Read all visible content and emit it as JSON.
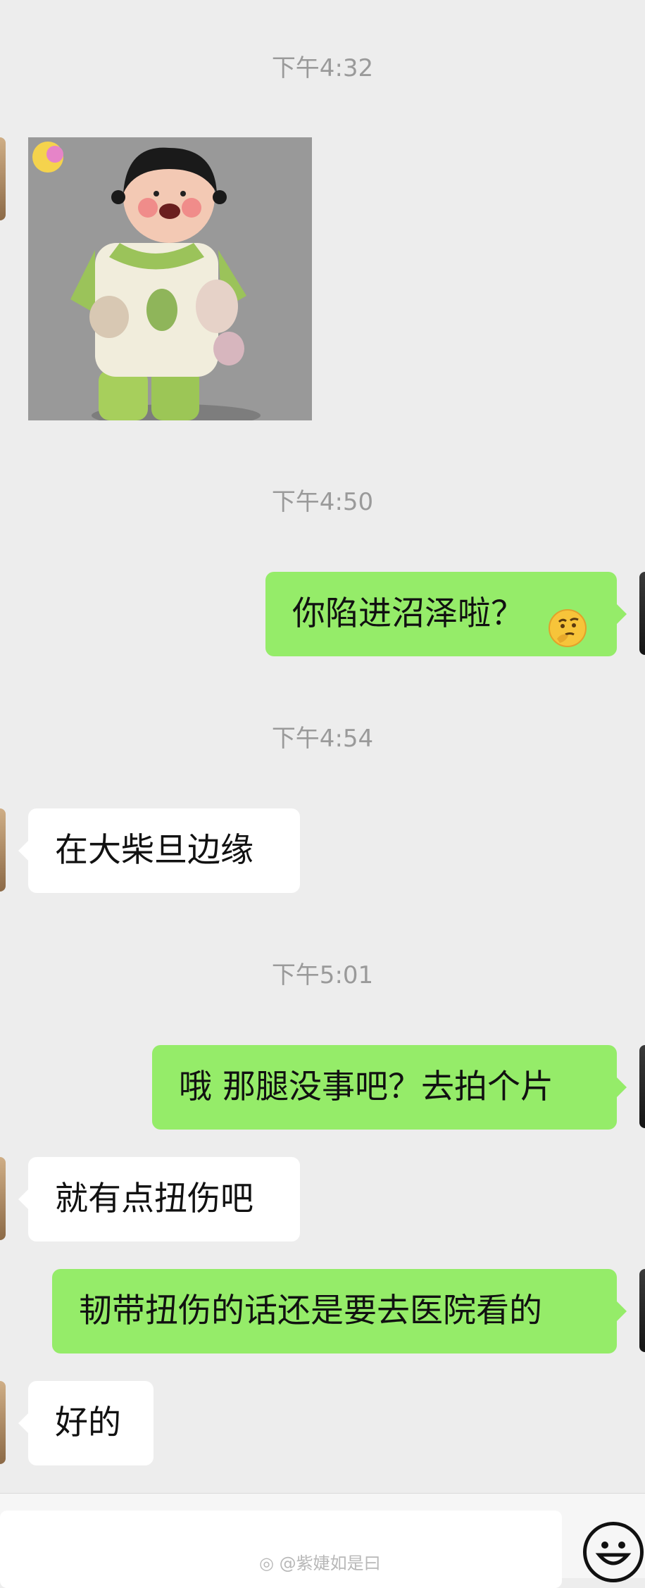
{
  "messages": {
    "time1": "下午4:32",
    "time2": "下午4:50",
    "time3": "下午4:54",
    "time4": "下午5:01",
    "msg_out1": "你陷进沼泽啦？",
    "msg_out1_emoji": "thinking-face-emoji",
    "msg_in1": "在大柴旦边缘",
    "msg_out2": "哦 那腿没事吧？去拍个片",
    "msg_in2": "就有点扭伤吧",
    "msg_out3": "韧带扭伤的话还是要去医院看的",
    "msg_in3": "好的"
  },
  "input_bar": {
    "emoji_button_icon": "smiley-face-icon"
  },
  "watermark": {
    "text": "@紫婕如是曰",
    "icon": "weibo-logo-icon"
  },
  "colors": {
    "background": "#ededed",
    "bubble_out": "#95ec69",
    "bubble_in": "#ffffff"
  }
}
